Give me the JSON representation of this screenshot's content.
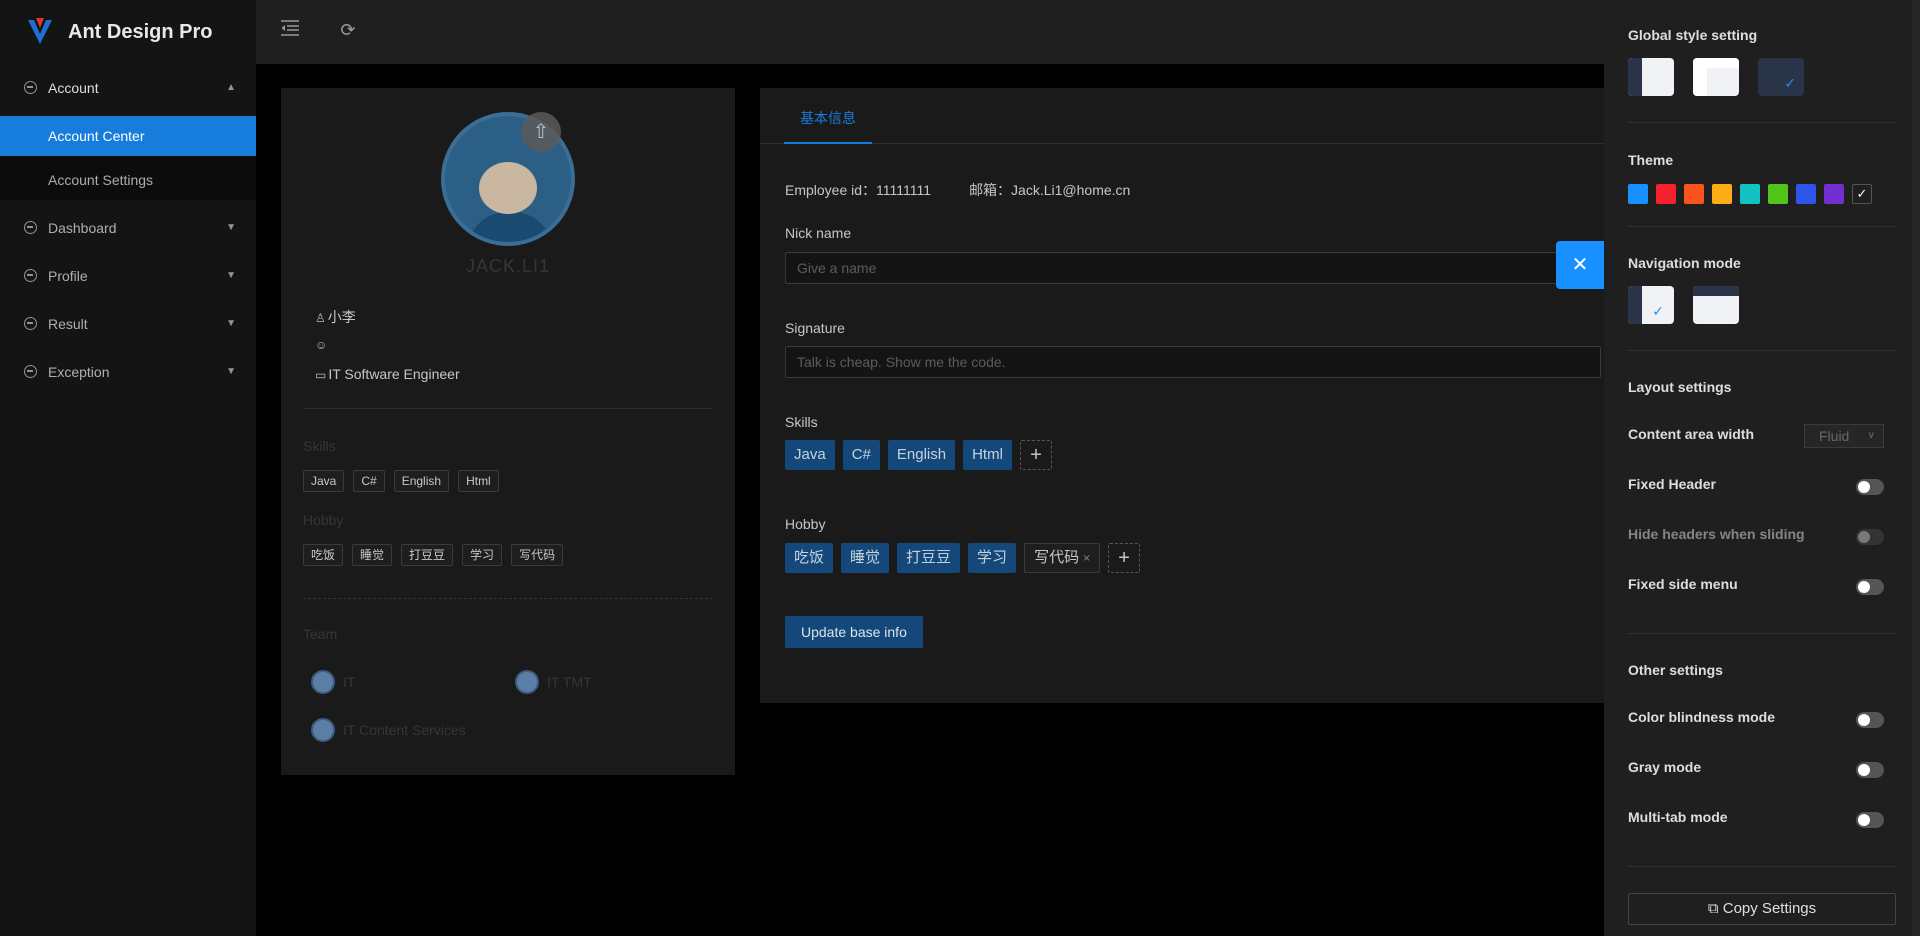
{
  "app": {
    "title": "Ant Design Pro"
  },
  "sidebar": {
    "items": [
      {
        "label": "Account",
        "expanded": true,
        "children": [
          {
            "label": "Account Center",
            "active": true
          },
          {
            "label": "Account Settings",
            "active": false
          }
        ]
      },
      {
        "label": "Dashboard"
      },
      {
        "label": "Profile"
      },
      {
        "label": "Result"
      },
      {
        "label": "Exception"
      }
    ]
  },
  "profile_card": {
    "username": "JACK.LI1",
    "nickname_line": "小李",
    "title_line": "IT Software Engineer",
    "skills_label": "Skills",
    "skills": [
      "Java",
      "C#",
      "English",
      "Html"
    ],
    "hobby_label": "Hobby",
    "hobbies": [
      "吃饭",
      "睡觉",
      "打豆豆",
      "学习",
      "写代码"
    ],
    "team_label": "Team",
    "teams": [
      "IT",
      "IT TMT",
      "IT Content Services"
    ]
  },
  "form": {
    "tab": "基本信息",
    "employee_id": "Employee id：11111111",
    "email": "邮箱：Jack.Li1@home.cn",
    "nickname_label": "Nick name",
    "nickname_placeholder": "Give a name",
    "signature_label": "Signature",
    "signature_placeholder": "Talk is cheap. Show me the code.",
    "skills_label": "Skills",
    "skills": [
      "Java",
      "C#",
      "English",
      "Html"
    ],
    "hobby_label": "Hobby",
    "hobbies": [
      "吃饭",
      "睡觉",
      "打豆豆",
      "学习"
    ],
    "hobby_closable": "写代码",
    "update_button": "Update base info"
  },
  "settings_drawer": {
    "global_style_heading": "Global style setting",
    "theme_heading": "Theme",
    "theme_colors": [
      "#1890ff",
      "#f5222d",
      "#fa541c",
      "#faad14",
      "#13c2c2",
      "#52c41a",
      "#2f54eb",
      "#722ed1"
    ],
    "navigation_heading": "Navigation mode",
    "layout_heading": "Layout settings",
    "content_width_label": "Content area width",
    "content_width_value": "Fluid",
    "fixed_header_label": "Fixed Header",
    "hide_headers_label": "Hide headers when sliding",
    "fixed_side_menu_label": "Fixed side menu",
    "other_heading": "Other settings",
    "color_blindness_label": "Color blindness mode",
    "gray_mode_label": "Gray mode",
    "multi_tab_label": "Multi-tab mode",
    "copy_button": "Copy Settings"
  }
}
